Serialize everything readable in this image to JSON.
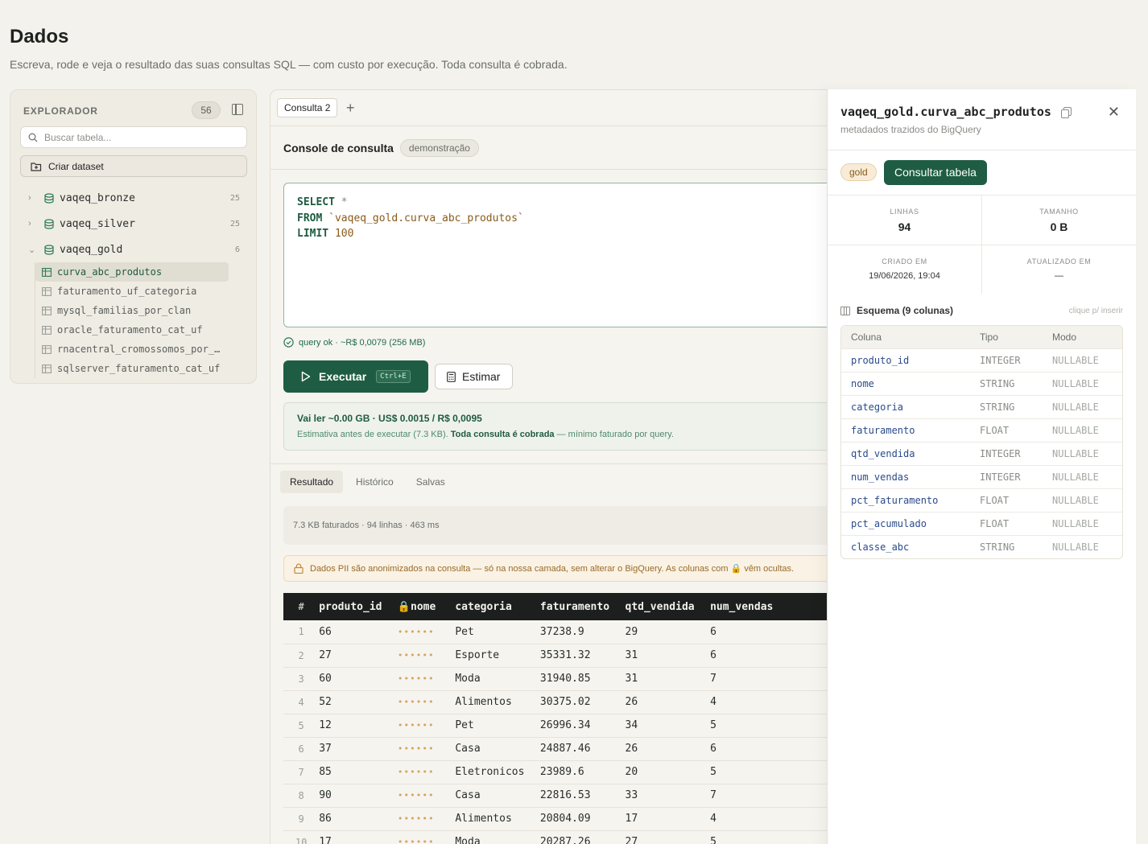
{
  "page": {
    "title": "Dados",
    "subtitle": "Escreva, rode e veja o resultado das suas consultas SQL — com custo por execução. Toda consulta é cobrada."
  },
  "explorer": {
    "title": "EXPLORADOR",
    "count": "56",
    "search_placeholder": "Buscar tabela...",
    "create_dataset_label": "Criar dataset",
    "datasets": [
      {
        "name": "vaqeq_bronze",
        "count": "25",
        "expanded": false
      },
      {
        "name": "vaqeq_silver",
        "count": "25",
        "expanded": false
      },
      {
        "name": "vaqeq_gold",
        "count": "6",
        "expanded": true
      }
    ],
    "gold_tables": [
      {
        "name": "curva_abc_produtos",
        "active": true
      },
      {
        "name": "faturamento_uf_categoria",
        "active": false
      },
      {
        "name": "mysql_familias_por_clan",
        "active": false
      },
      {
        "name": "oracle_faturamento_cat_uf",
        "active": false
      },
      {
        "name": "rnacentral_cromossomos_por_…",
        "active": false
      },
      {
        "name": "sqlserver_faturamento_cat_uf",
        "active": false
      }
    ]
  },
  "editor_panel": {
    "tab_label": "Consulta 2",
    "add_tab": "+",
    "console_title": "Console de consulta",
    "console_badge": "demonstração",
    "sql": {
      "select_kw": "SELECT",
      "star": "*",
      "from_kw": "FROM",
      "table": "`vaqeq_gold.curva_abc_produtos`",
      "limit_kw": "LIMIT",
      "limit_val": "100"
    },
    "status_text": "query ok · ~R$ 0,0079 (256 MB)",
    "run_label": "Executar",
    "run_shortcut": "Ctrl+E",
    "estimate_label": "Estimar",
    "estimate": {
      "main": "Vai ler ~0.00 GB · US$ 0.0015 / R$ 0,0095",
      "sub_prefix": "Estimativa antes de executar (7.3 KB). ",
      "sub_bold": "Toda consulta é cobrada",
      "sub_suffix": " — mínimo faturado por query."
    },
    "result_tabs": [
      "Resultado",
      "Histórico",
      "Salvas"
    ],
    "result_meta": "7.3 KB faturados · 94 linhas · 463 ms",
    "pii_notice": "Dados PII são anonimizados na consulta — só na nossa camada, sem alterar o BigQuery. As colunas com 🔒 vêm ocultas.",
    "grid": {
      "columns": [
        "#",
        "produto_id",
        "nome",
        "categoria",
        "faturamento",
        "qtd_vendida",
        "num_vendas"
      ],
      "masked": "••••••",
      "rows": [
        [
          "1",
          "66",
          "Pet",
          "37238.9",
          "29",
          "6"
        ],
        [
          "2",
          "27",
          "Esporte",
          "35331.32",
          "31",
          "6"
        ],
        [
          "3",
          "60",
          "Moda",
          "31940.85",
          "31",
          "7"
        ],
        [
          "4",
          "52",
          "Alimentos",
          "30375.02",
          "26",
          "4"
        ],
        [
          "5",
          "12",
          "Pet",
          "26996.34",
          "34",
          "5"
        ],
        [
          "6",
          "37",
          "Casa",
          "24887.46",
          "26",
          "6"
        ],
        [
          "7",
          "85",
          "Eletronicos",
          "23989.6",
          "20",
          "5"
        ],
        [
          "8",
          "90",
          "Casa",
          "22816.53",
          "33",
          "7"
        ],
        [
          "9",
          "86",
          "Alimentos",
          "20804.09",
          "17",
          "4"
        ],
        [
          "10",
          "17",
          "Moda",
          "20287.26",
          "27",
          "5"
        ]
      ]
    }
  },
  "details": {
    "title": "vaqeq_gold.curva_abc_produtos",
    "subtitle": "metadados trazidos do BigQuery",
    "layer_badge": "gold",
    "query_button": "Consultar tabela",
    "stats": {
      "rows_label": "LINHAS",
      "rows_value": "94",
      "size_label": "TAMANHO",
      "size_value": "0 B",
      "created_label": "CRIADO EM",
      "created_value": "19/06/2026, 19:04",
      "updated_label": "ATUALIZADO EM",
      "updated_value": "—"
    },
    "schema_title": "Esquema (9 colunas)",
    "schema_hint": "clique p/ inserir",
    "schema_headers": [
      "Coluna",
      "Tipo",
      "Modo"
    ],
    "schema": [
      {
        "name": "produto_id",
        "type": "INTEGER",
        "mode": "NULLABLE"
      },
      {
        "name": "nome",
        "type": "STRING",
        "mode": "NULLABLE"
      },
      {
        "name": "categoria",
        "type": "STRING",
        "mode": "NULLABLE"
      },
      {
        "name": "faturamento",
        "type": "FLOAT",
        "mode": "NULLABLE"
      },
      {
        "name": "qtd_vendida",
        "type": "INTEGER",
        "mode": "NULLABLE"
      },
      {
        "name": "num_vendas",
        "type": "INTEGER",
        "mode": "NULLABLE"
      },
      {
        "name": "pct_faturamento",
        "type": "FLOAT",
        "mode": "NULLABLE"
      },
      {
        "name": "pct_acumulado",
        "type": "FLOAT",
        "mode": "NULLABLE"
      },
      {
        "name": "classe_abc",
        "type": "STRING",
        "mode": "NULLABLE"
      }
    ]
  }
}
